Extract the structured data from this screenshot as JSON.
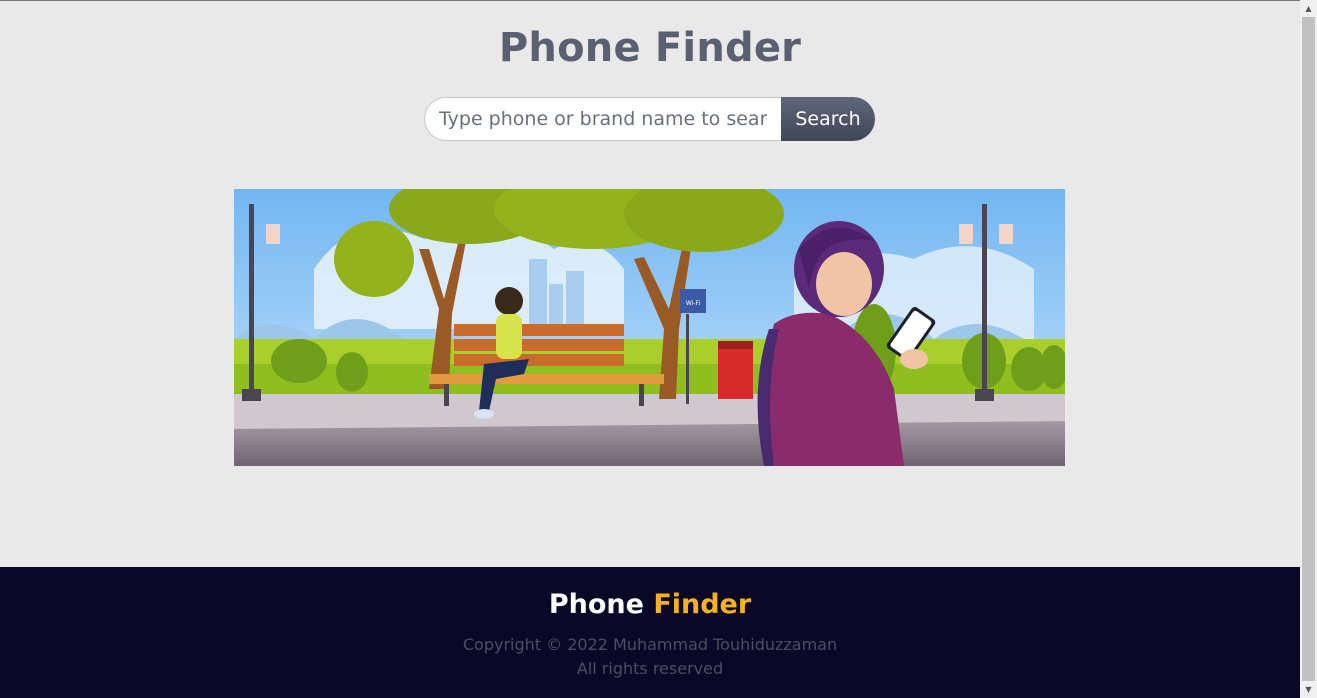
{
  "header": {
    "title": "Phone Finder"
  },
  "search": {
    "placeholder": "Type phone or brand name to search",
    "button_label": "Search"
  },
  "banner": {
    "sign_text": "Wi-Fi"
  },
  "footer": {
    "brand_part1": "Phone",
    "brand_part2": "Finder",
    "copyright": "Copyright © 2022 Muhammad Touhiduzzaman",
    "rights": "All rights reserved"
  },
  "scrollbar": {
    "up_icon": "▲",
    "down_icon": "▼"
  },
  "colors": {
    "page_background": "#e9e9e9",
    "title": "#5a6072",
    "button": "#4a5163",
    "footer_background": "#0b0827",
    "footer_accent": "#f5b21d"
  }
}
